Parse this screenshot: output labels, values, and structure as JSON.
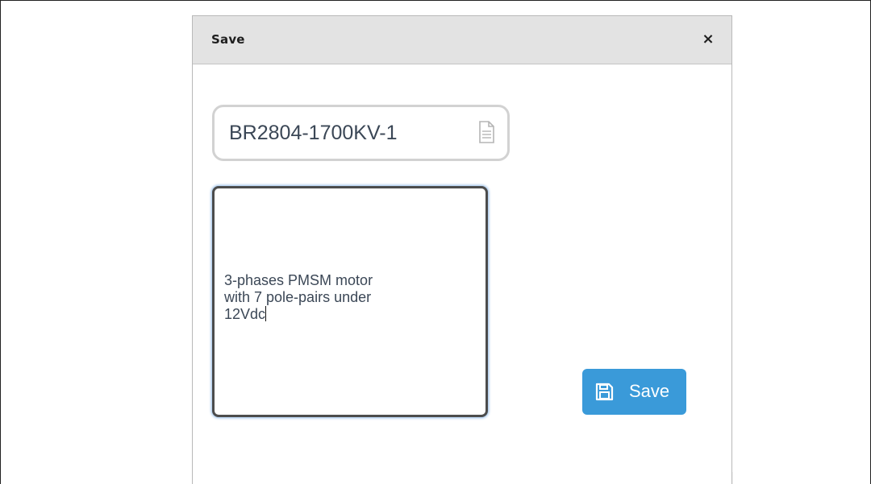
{
  "dialog": {
    "title": "Save",
    "close_symbol": "×",
    "close_icon": "close-icon"
  },
  "filename_field": {
    "value": "BR2804-1700KV-1",
    "icon": "file-icon"
  },
  "description_field": {
    "value": "3-phases PMSM motor\nwith 7 pole-pairs under\n12Vdc"
  },
  "save_button": {
    "label": "Save",
    "icon": "floppy-disk-icon",
    "color": "#3a9ad9"
  }
}
